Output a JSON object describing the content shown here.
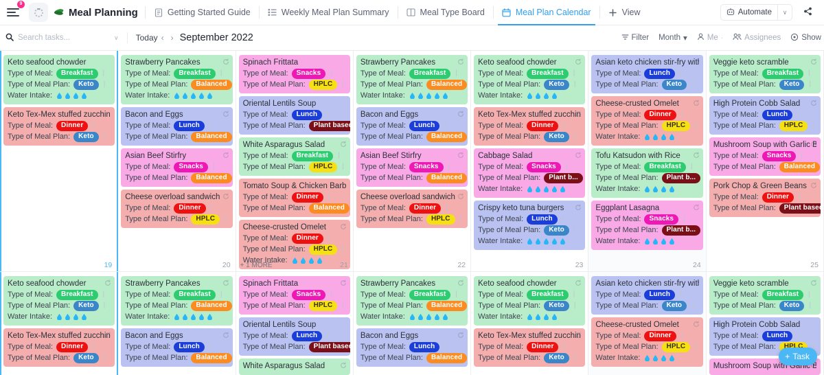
{
  "topbar": {
    "menu_badge": "9",
    "app_title": "Meal Planning",
    "tabs": [
      {
        "label": "Getting Started Guide",
        "icon": "doc-icon",
        "active": false
      },
      {
        "label": "Weekly Meal Plan Summary",
        "icon": "list-icon",
        "active": false
      },
      {
        "label": "Meal Type Board",
        "icon": "board-icon",
        "active": false
      },
      {
        "label": "Meal Plan Calendar",
        "icon": "calendar-icon",
        "active": true
      },
      {
        "label": "View",
        "icon": "plus-icon",
        "active": false
      }
    ],
    "automate_label": "Automate",
    "automate_caret": "∨",
    "share_label": ""
  },
  "toolbar": {
    "search_placeholder": "Search tasks...",
    "search_value": "",
    "filter_caret": "∨",
    "today_label": "Today",
    "prev_label": "‹",
    "next_label": "›",
    "month_label": "September 2022",
    "filter_label": "Filter",
    "period_label": "Month",
    "period_caret": "▾",
    "me_label": "Me",
    "dot": "·",
    "assignees_label": "Assignees",
    "show_label": "Show"
  },
  "labels": {
    "type_of_meal": "Type of Meal:",
    "type_of_meal_plan": "Type of Meal Plan:",
    "water_intake": "Water Intake:",
    "separator": "|",
    "more_suffix": "MORE"
  },
  "colors": {
    "accent": "#4bb7f5",
    "breakfast": "#2ecc71",
    "lunch": "#1b3ed8",
    "dinner": "#ee1111",
    "snacks": "#ee18b5",
    "keto": "#3a86c8",
    "balanced": "#fb8c21",
    "hplc": "#f5e014",
    "plant_based": "#7b0f18",
    "card_green": "#b9ecc8",
    "card_red": "#f4aeae",
    "card_blue": "#b9c2f0",
    "card_pink": "#f9a9e6",
    "water_drop": "#29b6f6"
  },
  "fab": {
    "label": "Task",
    "plus": "+"
  },
  "days": [
    {
      "num": "19",
      "today": true,
      "shade": false,
      "more": null,
      "cards": [
        {
          "title": "Keto seafood chowder",
          "bg": "#b9ecc8",
          "meal": "Breakfast",
          "meal_color": "#2ecc71",
          "plan": "Keto",
          "plan_color": "#3a86c8",
          "water": 4,
          "sync": false
        },
        {
          "title": "Keto Tex-Mex stuffed zucchini boat",
          "bg": "#f4aeae",
          "meal": "Dinner",
          "meal_color": "#ee1111",
          "plan": "Keto",
          "plan_color": "#3a86c8",
          "water": 0,
          "sync": false
        }
      ]
    },
    {
      "num": "20",
      "today": false,
      "shade": false,
      "more": null,
      "cards": [
        {
          "title": "Strawberry Pancakes",
          "bg": "#b9ecc8",
          "meal": "Breakfast",
          "meal_color": "#2ecc71",
          "plan": "Balanced",
          "plan_color": "#fb8c21",
          "water": 5,
          "sync": true
        },
        {
          "title": "Bacon and Eggs",
          "bg": "#b9c2f0",
          "meal": "Lunch",
          "meal_color": "#1b3ed8",
          "plan": "Balanced",
          "plan_color": "#fb8c21",
          "water": 0,
          "sync": true
        },
        {
          "title": "Asian Beef Stirfry",
          "bg": "#f9a9e6",
          "meal": "Snacks",
          "meal_color": "#ee18b5",
          "plan": "Balanced",
          "plan_color": "#fb8c21",
          "water": 0,
          "sync": true
        },
        {
          "title": "Cheese overload sandwich",
          "bg": "#f4aeae",
          "meal": "Dinner",
          "meal_color": "#ee1111",
          "plan": "HPLC",
          "plan_color": "#f5e014",
          "water": 0,
          "sync": true
        }
      ]
    },
    {
      "num": "21",
      "today": false,
      "shade": false,
      "more": "+ 1",
      "cards": [
        {
          "title": "Spinach Frittata",
          "bg": "#f9a9e6",
          "meal": "Snacks",
          "meal_color": "#ee18b5",
          "plan": "HPLC",
          "plan_color": "#f5e014",
          "water": 0,
          "sync": false
        },
        {
          "title": "Oriental Lentils Soup",
          "bg": "#b9c2f0",
          "meal": "Lunch",
          "meal_color": "#1b3ed8",
          "plan": "Plant based",
          "plan_color": "#7b0f18",
          "water": 0,
          "sync": false
        },
        {
          "title": "White Asparagus Salad",
          "bg": "#b9ecc8",
          "meal": "Breakfast",
          "meal_color": "#2ecc71",
          "plan": "HPLC",
          "plan_color": "#f5e014",
          "water": 0,
          "sync": true
        },
        {
          "title": "Tomato Soup & Chicken Barbecue",
          "bg": "#f4aeae",
          "meal": "Dinner",
          "meal_color": "#ee1111",
          "plan": "Balanced",
          "plan_color": "#fb8c21",
          "water": 0,
          "sync": false
        },
        {
          "title": "Cheese-crusted Omelet",
          "bg": "#f4aeae",
          "meal": "Dinner",
          "meal_color": "#ee1111",
          "plan": "HPLC",
          "plan_color": "#f5e014",
          "water": 4,
          "sync": true
        }
      ]
    },
    {
      "num": "22",
      "today": false,
      "shade": false,
      "more": null,
      "cards": [
        {
          "title": "Strawberry Pancakes",
          "bg": "#b9ecc8",
          "meal": "Breakfast",
          "meal_color": "#2ecc71",
          "plan": "Balanced",
          "plan_color": "#fb8c21",
          "water": 5,
          "sync": true
        },
        {
          "title": "Bacon and Eggs",
          "bg": "#b9c2f0",
          "meal": "Lunch",
          "meal_color": "#1b3ed8",
          "plan": "Balanced",
          "plan_color": "#fb8c21",
          "water": 0,
          "sync": true
        },
        {
          "title": "Asian Beef Stirfry",
          "bg": "#f9a9e6",
          "meal": "Snacks",
          "meal_color": "#ee18b5",
          "plan": "Balanced",
          "plan_color": "#fb8c21",
          "water": 0,
          "sync": true
        },
        {
          "title": "Cheese overload sandwich",
          "bg": "#f4aeae",
          "meal": "Dinner",
          "meal_color": "#ee1111",
          "plan": "HPLC",
          "plan_color": "#f5e014",
          "water": 0,
          "sync": true
        }
      ]
    },
    {
      "num": "23",
      "today": false,
      "shade": false,
      "more": null,
      "cards": [
        {
          "title": "Keto seafood chowder",
          "bg": "#b9ecc8",
          "meal": "Breakfast",
          "meal_color": "#2ecc71",
          "plan": "Keto",
          "plan_color": "#3a86c8",
          "water": 4,
          "sync": true
        },
        {
          "title": "Keto Tex-Mex stuffed zucchini b",
          "bg": "#f4aeae",
          "meal": "Dinner",
          "meal_color": "#ee1111",
          "plan": "Keto",
          "plan_color": "#3a86c8",
          "water": 0,
          "sync": true
        },
        {
          "title": "Cabbage Salad",
          "bg": "#f9a9e6",
          "meal": "Snacks",
          "meal_color": "#ee18b5",
          "plan": "Plant b...",
          "plan_color": "#7b0f18",
          "water": 5,
          "sync": true
        },
        {
          "title": "Crispy keto tuna burgers",
          "bg": "#b9c2f0",
          "meal": "Lunch",
          "meal_color": "#1b3ed8",
          "plan": "Keto",
          "plan_color": "#3a86c8",
          "water": 5,
          "sync": true
        }
      ]
    },
    {
      "num": "24",
      "today": false,
      "shade": true,
      "more": null,
      "cards": [
        {
          "title": "Asian keto chicken stir-fry with bro",
          "bg": "#b9c2f0",
          "meal": "Lunch",
          "meal_color": "#1b3ed8",
          "plan": "Keto",
          "plan_color": "#3a86c8",
          "water": 0,
          "sync": false
        },
        {
          "title": "Cheese-crusted Omelet",
          "bg": "#f4aeae",
          "meal": "Dinner",
          "meal_color": "#ee1111",
          "plan": "HPLC",
          "plan_color": "#f5e014",
          "water": 4,
          "sync": true
        },
        {
          "title": "Tofu Katsudon with Rice",
          "bg": "#b9ecc8",
          "meal": "Breakfast",
          "meal_color": "#2ecc71",
          "plan": "Plant b...",
          "plan_color": "#7b0f18",
          "water": 4,
          "sync": true
        },
        {
          "title": "Eggplant Lasagna",
          "bg": "#f9a9e6",
          "meal": "Snacks",
          "meal_color": "#ee18b5",
          "plan": "Plant b...",
          "plan_color": "#7b0f18",
          "water": 4,
          "sync": true
        }
      ]
    },
    {
      "num": "25",
      "today": false,
      "shade": false,
      "more": null,
      "cards": [
        {
          "title": "Veggie keto scramble",
          "bg": "#b9ecc8",
          "meal": "Breakfast",
          "meal_color": "#2ecc71",
          "plan": "Keto",
          "plan_color": "#3a86c8",
          "water": 0,
          "sync": true
        },
        {
          "title": "High Protein Cobb Salad",
          "bg": "#b9c2f0",
          "meal": "Lunch",
          "meal_color": "#1b3ed8",
          "plan": "HPLC",
          "plan_color": "#f5e014",
          "water": 0,
          "sync": true
        },
        {
          "title": "Mushroom Soup with Garlic Bre",
          "bg": "#f9a9e6",
          "meal": "Snacks",
          "meal_color": "#ee18b5",
          "plan": "Balanced",
          "plan_color": "#fb8c21",
          "water": 0,
          "sync": true
        },
        {
          "title": "Pork Chop & Green Beans",
          "bg": "#f4aeae",
          "meal": "Dinner",
          "meal_color": "#ee1111",
          "plan": "Plant based",
          "plan_color": "#7b0f18",
          "water": 0,
          "sync": true
        }
      ]
    }
  ],
  "days_row2": [
    {
      "num": "",
      "today": true,
      "shade": false,
      "more": null,
      "cards": [
        {
          "title": "Keto seafood chowder",
          "bg": "#b9ecc8",
          "meal": "Breakfast",
          "meal_color": "#2ecc71",
          "plan": "Keto",
          "plan_color": "#3a86c8",
          "water": 4,
          "sync": true
        },
        {
          "title": "Keto Tex-Mex stuffed zucchini b",
          "bg": "#f4aeae",
          "meal": "Dinner",
          "meal_color": "#ee1111",
          "plan": "Keto",
          "plan_color": "#3a86c8",
          "water": 0,
          "sync": true
        }
      ]
    },
    {
      "num": "",
      "today": false,
      "shade": false,
      "more": null,
      "cards": [
        {
          "title": "Strawberry Pancakes",
          "bg": "#b9ecc8",
          "meal": "Breakfast",
          "meal_color": "#2ecc71",
          "plan": "Balanced",
          "plan_color": "#fb8c21",
          "water": 5,
          "sync": true
        },
        {
          "title": "Bacon and Eggs",
          "bg": "#b9c2f0",
          "meal": "Lunch",
          "meal_color": "#1b3ed8",
          "plan": "Balanced",
          "plan_color": "#fb8c21",
          "water": 0,
          "sync": true
        }
      ]
    },
    {
      "num": "",
      "today": false,
      "shade": false,
      "more": null,
      "cards": [
        {
          "title": "Spinach Frittata",
          "bg": "#f9a9e6",
          "meal": "Snacks",
          "meal_color": "#ee18b5",
          "plan": "HPLC",
          "plan_color": "#f5e014",
          "water": 0,
          "sync": true
        },
        {
          "title": "Oriental Lentils Soup",
          "bg": "#b9c2f0",
          "meal": "Lunch",
          "meal_color": "#1b3ed8",
          "plan": "Plant based",
          "plan_color": "#7b0f18",
          "water": 0,
          "sync": false
        },
        {
          "title": "White Asparagus Salad",
          "bg": "#b9ecc8",
          "meal": "",
          "meal_color": "#2ecc71",
          "plan": "",
          "plan_color": "#f5e014",
          "water": 0,
          "sync": true
        }
      ]
    },
    {
      "num": "",
      "today": false,
      "shade": false,
      "more": null,
      "cards": [
        {
          "title": "Strawberry Pancakes",
          "bg": "#b9ecc8",
          "meal": "Breakfast",
          "meal_color": "#2ecc71",
          "plan": "Balanced",
          "plan_color": "#fb8c21",
          "water": 5,
          "sync": true
        },
        {
          "title": "Bacon and Eggs",
          "bg": "#b9c2f0",
          "meal": "Lunch",
          "meal_color": "#1b3ed8",
          "plan": "Balanced",
          "plan_color": "#fb8c21",
          "water": 0,
          "sync": true
        }
      ]
    },
    {
      "num": "",
      "today": false,
      "shade": false,
      "more": null,
      "cards": [
        {
          "title": "Keto seafood chowder",
          "bg": "#b9ecc8",
          "meal": "Breakfast",
          "meal_color": "#2ecc71",
          "plan": "Keto",
          "plan_color": "#3a86c8",
          "water": 4,
          "sync": true
        },
        {
          "title": "Keto Tex-Mex stuffed zucchini b",
          "bg": "#f4aeae",
          "meal": "Dinner",
          "meal_color": "#ee1111",
          "plan": "Keto",
          "plan_color": "#3a86c8",
          "water": 0,
          "sync": true
        }
      ]
    },
    {
      "num": "",
      "today": false,
      "shade": true,
      "more": null,
      "cards": [
        {
          "title": "Asian keto chicken stir-fry with b",
          "bg": "#b9c2f0",
          "meal": "Lunch",
          "meal_color": "#1b3ed8",
          "plan": "Keto",
          "plan_color": "#3a86c8",
          "water": 0,
          "sync": false
        },
        {
          "title": "Cheese-crusted Omelet",
          "bg": "#f4aeae",
          "meal": "Dinner",
          "meal_color": "#ee1111",
          "plan": "HPLC",
          "plan_color": "#f5e014",
          "water": 4,
          "sync": true
        }
      ]
    },
    {
      "num": "",
      "today": false,
      "shade": false,
      "more": null,
      "cards": [
        {
          "title": "Veggie keto scramble",
          "bg": "#b9ecc8",
          "meal": "Breakfast",
          "meal_color": "#2ecc71",
          "plan": "Keto",
          "plan_color": "#3a86c8",
          "water": 0,
          "sync": true
        },
        {
          "title": "High Protein Cobb Salad",
          "bg": "#b9c2f0",
          "meal": "Lunch",
          "meal_color": "#1b3ed8",
          "plan": "HPLC",
          "plan_color": "#f5e014",
          "water": 0,
          "sync": false
        },
        {
          "title": "Mushroom Soup with Garlic Bre",
          "bg": "#f9a9e6",
          "meal": "",
          "meal_color": "#ee18b5",
          "plan": "",
          "plan_color": "#fb8c21",
          "water": 0,
          "sync": true
        }
      ]
    }
  ]
}
